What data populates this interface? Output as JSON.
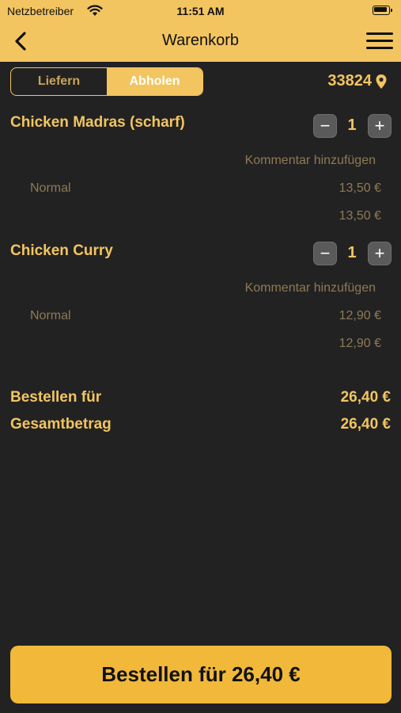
{
  "status_bar": {
    "carrier": "Netzbetreiber",
    "time": "11:51 AM"
  },
  "nav": {
    "title": "Warenkorb"
  },
  "mode_toggle": {
    "options": [
      "Liefern",
      "Abholen"
    ],
    "selected": "Abholen"
  },
  "location": {
    "zip": "33824"
  },
  "cart": {
    "items": [
      {
        "name": "Chicken Madras (scharf)",
        "quantity": "1",
        "comment_label": "Kommentar hinzufügen",
        "variant": "Normal",
        "variant_price": "13,50 €",
        "line_total": "13,50 €"
      },
      {
        "name": "Chicken Curry",
        "quantity": "1",
        "comment_label": "Kommentar hinzufügen",
        "variant": "Normal",
        "variant_price": "12,90 €",
        "line_total": "12,90 €"
      }
    ]
  },
  "summary": {
    "order_for_label": "Bestellen für",
    "order_for_value": "26,40 €",
    "total_label": "Gesamtbetrag",
    "total_value": "26,40 €"
  },
  "cta": {
    "label": "Bestellen für 26,40 €"
  },
  "colors": {
    "accent": "#f3c561",
    "background": "#222222",
    "cta": "#f1b83a",
    "muted_text": "#8f7a55"
  }
}
